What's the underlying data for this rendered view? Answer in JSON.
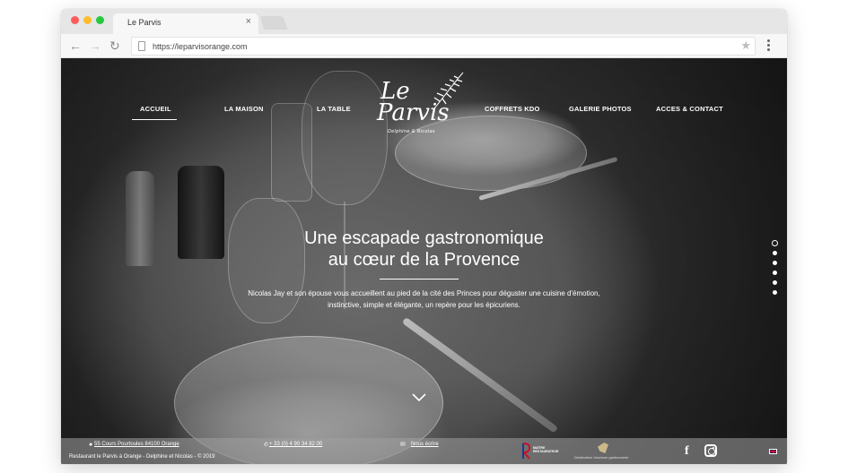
{
  "browser": {
    "tab_title": "Le Parvis",
    "tab_close": "×",
    "url": "https://leparvisorange.com",
    "back": "←",
    "forward": "→",
    "reload": "↻",
    "star": "★"
  },
  "nav": {
    "items": [
      "ACCUEIL",
      "LA MAISON",
      "LA TABLE",
      "COFFRETS KDO",
      "GALERIE PHOTOS",
      "ACCES & CONTACT"
    ],
    "active": "ACCUEIL"
  },
  "logo": {
    "line1": "Le",
    "line2": "Parvis",
    "sub": "Delphine & Nicolas"
  },
  "hero": {
    "headline_1": "Une escapade gastronomique",
    "headline_2": "au cœur de la Provence",
    "intro": "Nicolas Jay et son épouse vous accueillent au pied de la cité des Princes pour déguster une cuisine d'émotion, instinctive, simple et élégante, un repère pour les épicuriens."
  },
  "slider": {
    "count": 6,
    "active_index": 0
  },
  "footer": {
    "address": "55 Cours Pourtoules 84100 Orange",
    "phone": "+ 33 (0) 4 90 34 82 00",
    "email_label": "Nous écrire",
    "copyright": "Restaurant le Parvis à Orange - Delphine et Nicolas - © 2019",
    "maitre_line1": "MAÎTRE",
    "maitre_line2": "RESTAURATEUR",
    "partner_text": "Destination Vaucluse gastronomie"
  }
}
